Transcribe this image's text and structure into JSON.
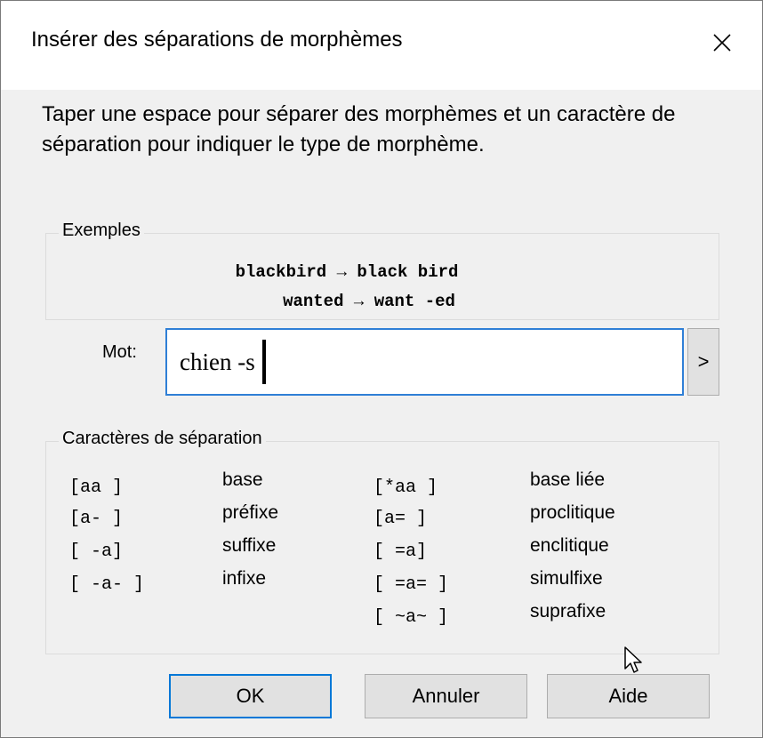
{
  "window": {
    "title": "Insérer des séparations de morphèmes",
    "close_icon": "close-icon"
  },
  "instructions": "Taper une espace pour séparer des morphèmes et un caractère de séparation pour indiquer le type de morphème.",
  "examples": {
    "label": "Exemples",
    "lines": [
      "blackbird → black bird",
      "wanted → want -ed"
    ]
  },
  "word": {
    "label": "Mot:",
    "value": "chien -s",
    "go_label": ">"
  },
  "separators": {
    "label": "Caractères de séparation",
    "left": [
      {
        "code": "[aa ]",
        "name": "base"
      },
      {
        "code": "[a- ]",
        "name": "préfixe"
      },
      {
        "code": "[ -a]",
        "name": "suffixe"
      },
      {
        "code": "[ -a- ]",
        "name": "infixe"
      }
    ],
    "right": [
      {
        "code": "[*aa ]",
        "name": "base liée"
      },
      {
        "code": "[a= ]",
        "name": "proclitique"
      },
      {
        "code": "[ =a]",
        "name": "enclitique"
      },
      {
        "code": "[ =a= ]",
        "name": "simulfixe"
      },
      {
        "code": "[ ~a~ ]",
        "name": "suprafixe"
      }
    ]
  },
  "buttons": {
    "ok": "OK",
    "cancel": "Annuler",
    "help": "Aide"
  },
  "colors": {
    "focus_border": "#2f7fd6",
    "default_button_border": "#0078d7"
  }
}
